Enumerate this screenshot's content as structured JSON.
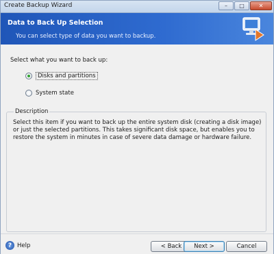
{
  "window": {
    "title": "Create Backup Wizard",
    "controls": {
      "minimize": "–",
      "maximize": "□",
      "close": "✕"
    }
  },
  "banner": {
    "title": "Data to Back Up Selection",
    "subtitle": "You can select type of data you want to backup.",
    "icon": "backup-computer-icon"
  },
  "content": {
    "prompt": "Select what you want to back up:",
    "options": [
      {
        "label": "Disks and partitions",
        "selected": true
      },
      {
        "label": "System state",
        "selected": false
      }
    ],
    "description": {
      "legend": "Description",
      "text": "Select this item if you want to back up the entire system disk (creating a disk image) or just the selected partitions. This takes significant disk space, but enables you to restore the system in minutes in case of severe data damage or hardware failure."
    }
  },
  "footer": {
    "help": "Help",
    "help_icon": "?",
    "back": "< Back",
    "next": "Next >",
    "cancel": "Cancel"
  },
  "colors": {
    "banner": "#2f6bd0",
    "selected_radio": "#2fa12f",
    "close_button": "#c74b2e"
  }
}
